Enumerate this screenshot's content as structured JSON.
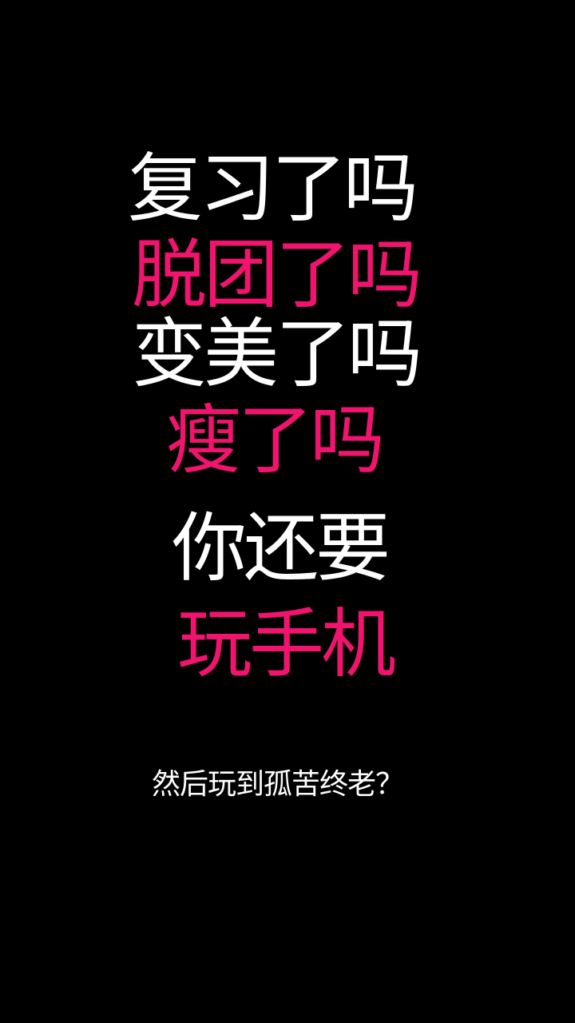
{
  "lines": [
    {
      "text": "复习了吗"
    },
    {
      "text": "脱团了吗"
    },
    {
      "text": "变美了吗"
    },
    {
      "text": "瘦了吗"
    },
    {
      "text": "你还要"
    },
    {
      "text": "玩手机"
    }
  ],
  "footer": {
    "text": "然后玩到孤苦终老？"
  },
  "colors": {
    "background": "#000000",
    "white_text": "#ffffff",
    "accent_pink": "#f0146e"
  }
}
